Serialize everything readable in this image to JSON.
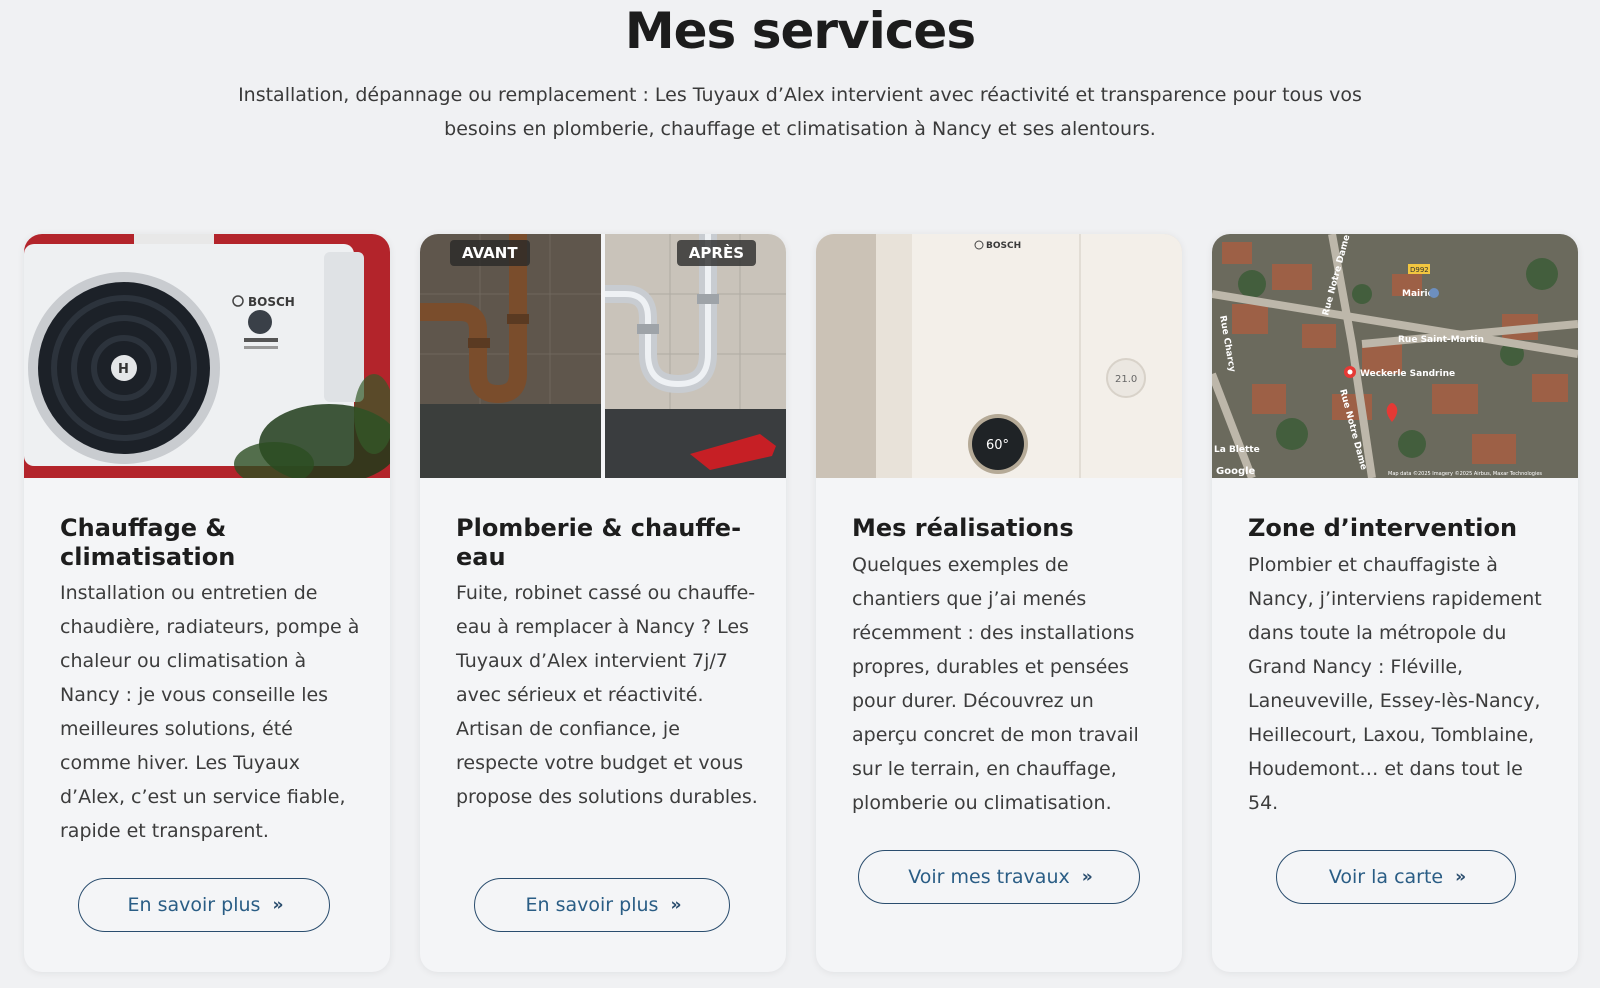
{
  "header": {
    "title": "Mes services",
    "intro": "Installation, dépannage ou remplacement : Les Tuyaux d’Alex intervient avec réactivité et transparence pour tous vos besoins en plomberie, chauffage et climatisation à Nancy et ses alentours."
  },
  "cards": [
    {
      "title": "Chauffage & climatisation",
      "text": "Installation ou entretien de chaudière, radiateurs, pompe à chaleur ou climatisation à Nancy : je vous conseille les meilleures solutions, été comme hiver. Les Tuyaux d’Alex, c’est un service fiable, rapide et transparent.",
      "button": "En savoir plus",
      "image": {
        "brand": "BOSCH"
      }
    },
    {
      "title": "Plomberie & chauffe-eau",
      "text": "Fuite, robinet cassé ou chauffe-eau à remplacer à Nancy ? Les Tuyaux d’Alex intervient 7j/7 avec sérieux et réactivité. Artisan de confiance, je respecte votre budget et vous propose des solutions durables.",
      "button": "En savoir plus",
      "image": {
        "before_label": "AVANT",
        "after_label": "APRÈS"
      }
    },
    {
      "title": "Mes réalisations",
      "text": "Quelques exemples de chantiers que j’ai menés récemment : des installations propres, durables et pensées pour durer. Découvrez un aperçu concret de mon travail sur le terrain, en chauffage, plomberie ou climatisation.",
      "button": "Voir mes travaux",
      "image": {
        "brand": "BOSCH",
        "dial": "60°",
        "thermo": "21.0"
      }
    },
    {
      "title": "Zone d’intervention",
      "text": "Plombier et chauffagiste à Nancy, j’interviens rapidement dans toute la métropole du Grand Nancy : Fléville, Laneuveville, Essey-lès-Nancy, Heillecourt, Laxou, Tomblaine, Houdemont… et dans tout le 54.",
      "button": "Voir la carte",
      "image": {
        "street1": "Rue Saint-Martin",
        "street2": "Rue Notre Dame",
        "street3": "Rue Notre Dame",
        "street4": "Rue Charcy",
        "poi1": "Mairie",
        "poi2": "Weckerle Sandrine",
        "road": "D992",
        "place": "La Blette",
        "google": "Google",
        "credit": "Map data ©2025 Imagery ©2025 Airbus, Maxar Technologies"
      }
    }
  ],
  "colors": {
    "button_border": "#2a4d6e",
    "button_text": "#2a5d85",
    "background": "#f0f1f3"
  }
}
